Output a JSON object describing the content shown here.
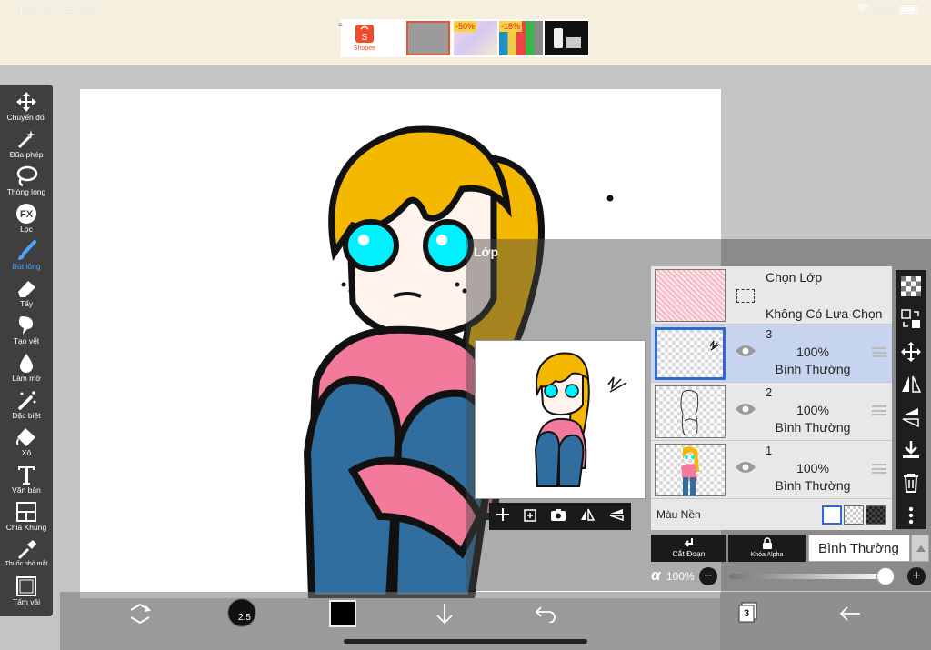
{
  "status_bar": {
    "time": "21:33",
    "date": "Th 2 29 thg 3",
    "battery": "82%"
  },
  "ad": {
    "items": [
      "Shopee",
      "",
      "-50%",
      "-18%",
      ""
    ]
  },
  "tools": [
    {
      "label": "Chuyển đổi",
      "icon": "move-icon"
    },
    {
      "label": "Đũa phép",
      "icon": "magic-wand-icon"
    },
    {
      "label": "Thòng lọng",
      "icon": "lasso-icon"
    },
    {
      "label": "Lọc",
      "icon": "fx-filter-icon"
    },
    {
      "label": "Bút lông",
      "icon": "brush-icon"
    },
    {
      "label": "Tẩy",
      "icon": "eraser-icon"
    },
    {
      "label": "Tạo vết",
      "icon": "smudge-icon"
    },
    {
      "label": "Làm mờ",
      "icon": "blur-icon"
    },
    {
      "label": "Đặc biệt",
      "icon": "special-brush-icon"
    },
    {
      "label": "Xô",
      "icon": "bucket-icon"
    },
    {
      "label": "Văn bản",
      "icon": "text-icon"
    },
    {
      "label": "Chia Khung",
      "icon": "frame-divider-icon"
    },
    {
      "label": "Thuốc nhỏ mắt",
      "icon": "eyedropper-icon"
    },
    {
      "label": "Tấm vải",
      "icon": "canvas-icon"
    }
  ],
  "active_tool": "Bút lông",
  "layers_panel": {
    "title": "Lớp",
    "selection": {
      "title": "Chọn Lớp",
      "status": "Không Có Lựa Chọn"
    },
    "layers": [
      {
        "number": "3",
        "opacity": "100%",
        "blend": "Bình Thường",
        "selected": true
      },
      {
        "number": "2",
        "opacity": "100%",
        "blend": "Bình Thường",
        "selected": false
      },
      {
        "number": "1",
        "opacity": "100%",
        "blend": "Bình Thường",
        "selected": false
      }
    ],
    "background_label": "Màu Nền",
    "clip_label": "Cắt Đoạn",
    "alpha_lock_label": "Khóa Alpha",
    "blend_mode": "Bình Thường",
    "alpha_symbol": "α",
    "opacity_value": "100%",
    "opacity_fraction": 1.0
  },
  "bottom_bar": {
    "brush_size": "2.5",
    "layer_count": "3"
  },
  "colors": {
    "accent": "#2d6ad4",
    "toolbar": "#3f3f3f",
    "hair": "#f5b800",
    "eyes": "#00f0ff",
    "shirt": "#f47a9b",
    "pants": "#2f6e9e"
  }
}
